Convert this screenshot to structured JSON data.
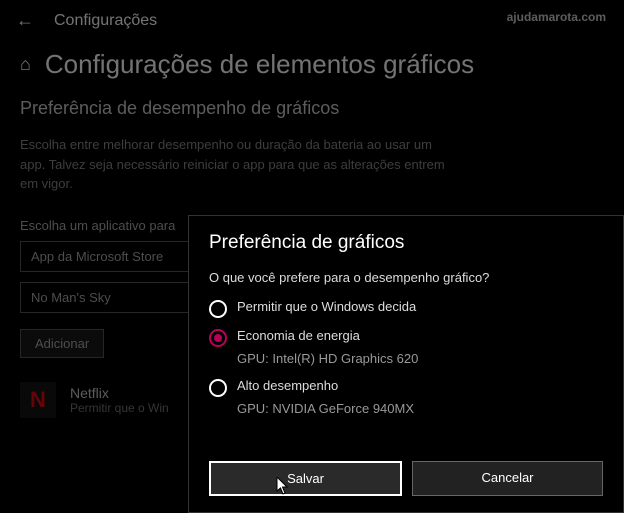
{
  "topbar": {
    "title": "Configurações"
  },
  "watermark": "ajudamarota.com",
  "header": {
    "title": "Configurações de elementos gráficos"
  },
  "section": {
    "title": "Preferência de desempenho de gráficos",
    "desc": "Escolha entre melhorar desempenho ou duração da bateria ao usar um app. Talvez seja necessário reiniciar o app para que as alterações entrem em vigor."
  },
  "picker": {
    "label": "Escolha um aplicativo para",
    "select1": "App da Microsoft Store",
    "select2": "No Man's Sky",
    "add": "Adicionar"
  },
  "app": {
    "icon_letter": "N",
    "name": "Netflix",
    "subtitle": "Permitir que o Win"
  },
  "dialog": {
    "title": "Preferência de gráficos",
    "question": "O que você prefere para o desempenho gráfico?",
    "opt1": "Permitir que o Windows decida",
    "opt2": "Economia de energia",
    "opt2_sub": "GPU: Intel(R) HD Graphics 620",
    "opt3": "Alto desempenho",
    "opt3_sub": "GPU: NVIDIA GeForce 940MX",
    "save": "Salvar",
    "cancel": "Cancelar"
  }
}
